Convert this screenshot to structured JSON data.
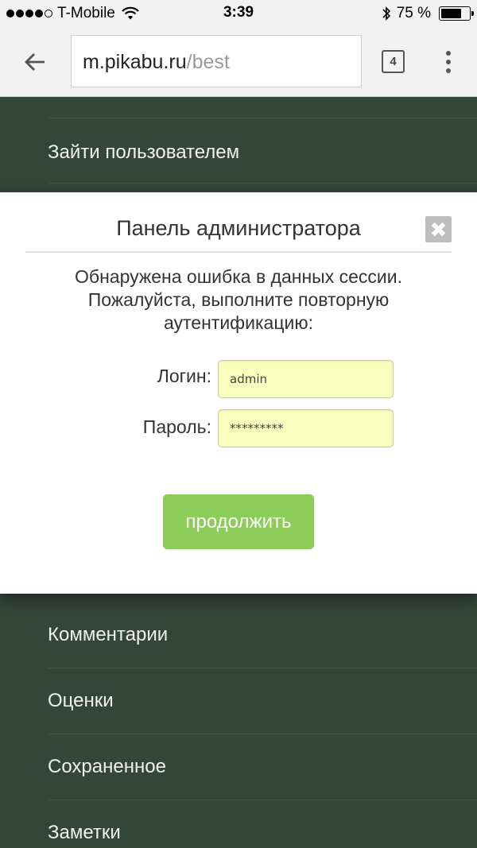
{
  "status_bar": {
    "carrier": "T-Mobile",
    "time": "3:39",
    "battery_percent_text": "75 %",
    "battery_level": 0.75,
    "signal_bars_filled": 4,
    "signal_bars_total": 5
  },
  "browser": {
    "url_host": "m.pikabu.ru",
    "url_path": "/best",
    "tab_count": "4"
  },
  "menu": {
    "items": [
      {
        "label": "Зайти пользователем"
      },
      {
        "label": "Комментарии"
      },
      {
        "label": "Оценки"
      },
      {
        "label": "Сохраненное"
      },
      {
        "label": "Заметки"
      }
    ]
  },
  "modal": {
    "title": "Панель администратора",
    "message": "Обнаружена ошибка в данных сессии. Пожалуйста, выполните повторную аутентификацию:",
    "login_label": "Логин:",
    "login_value": "admin",
    "password_label": "Пароль:",
    "password_value": "*********",
    "submit_label": "продолжить",
    "close_glyph": "✖"
  },
  "colors": {
    "background": "#344539",
    "accent_button": "#8ccd5a",
    "input_fill": "#f9ffbd"
  }
}
